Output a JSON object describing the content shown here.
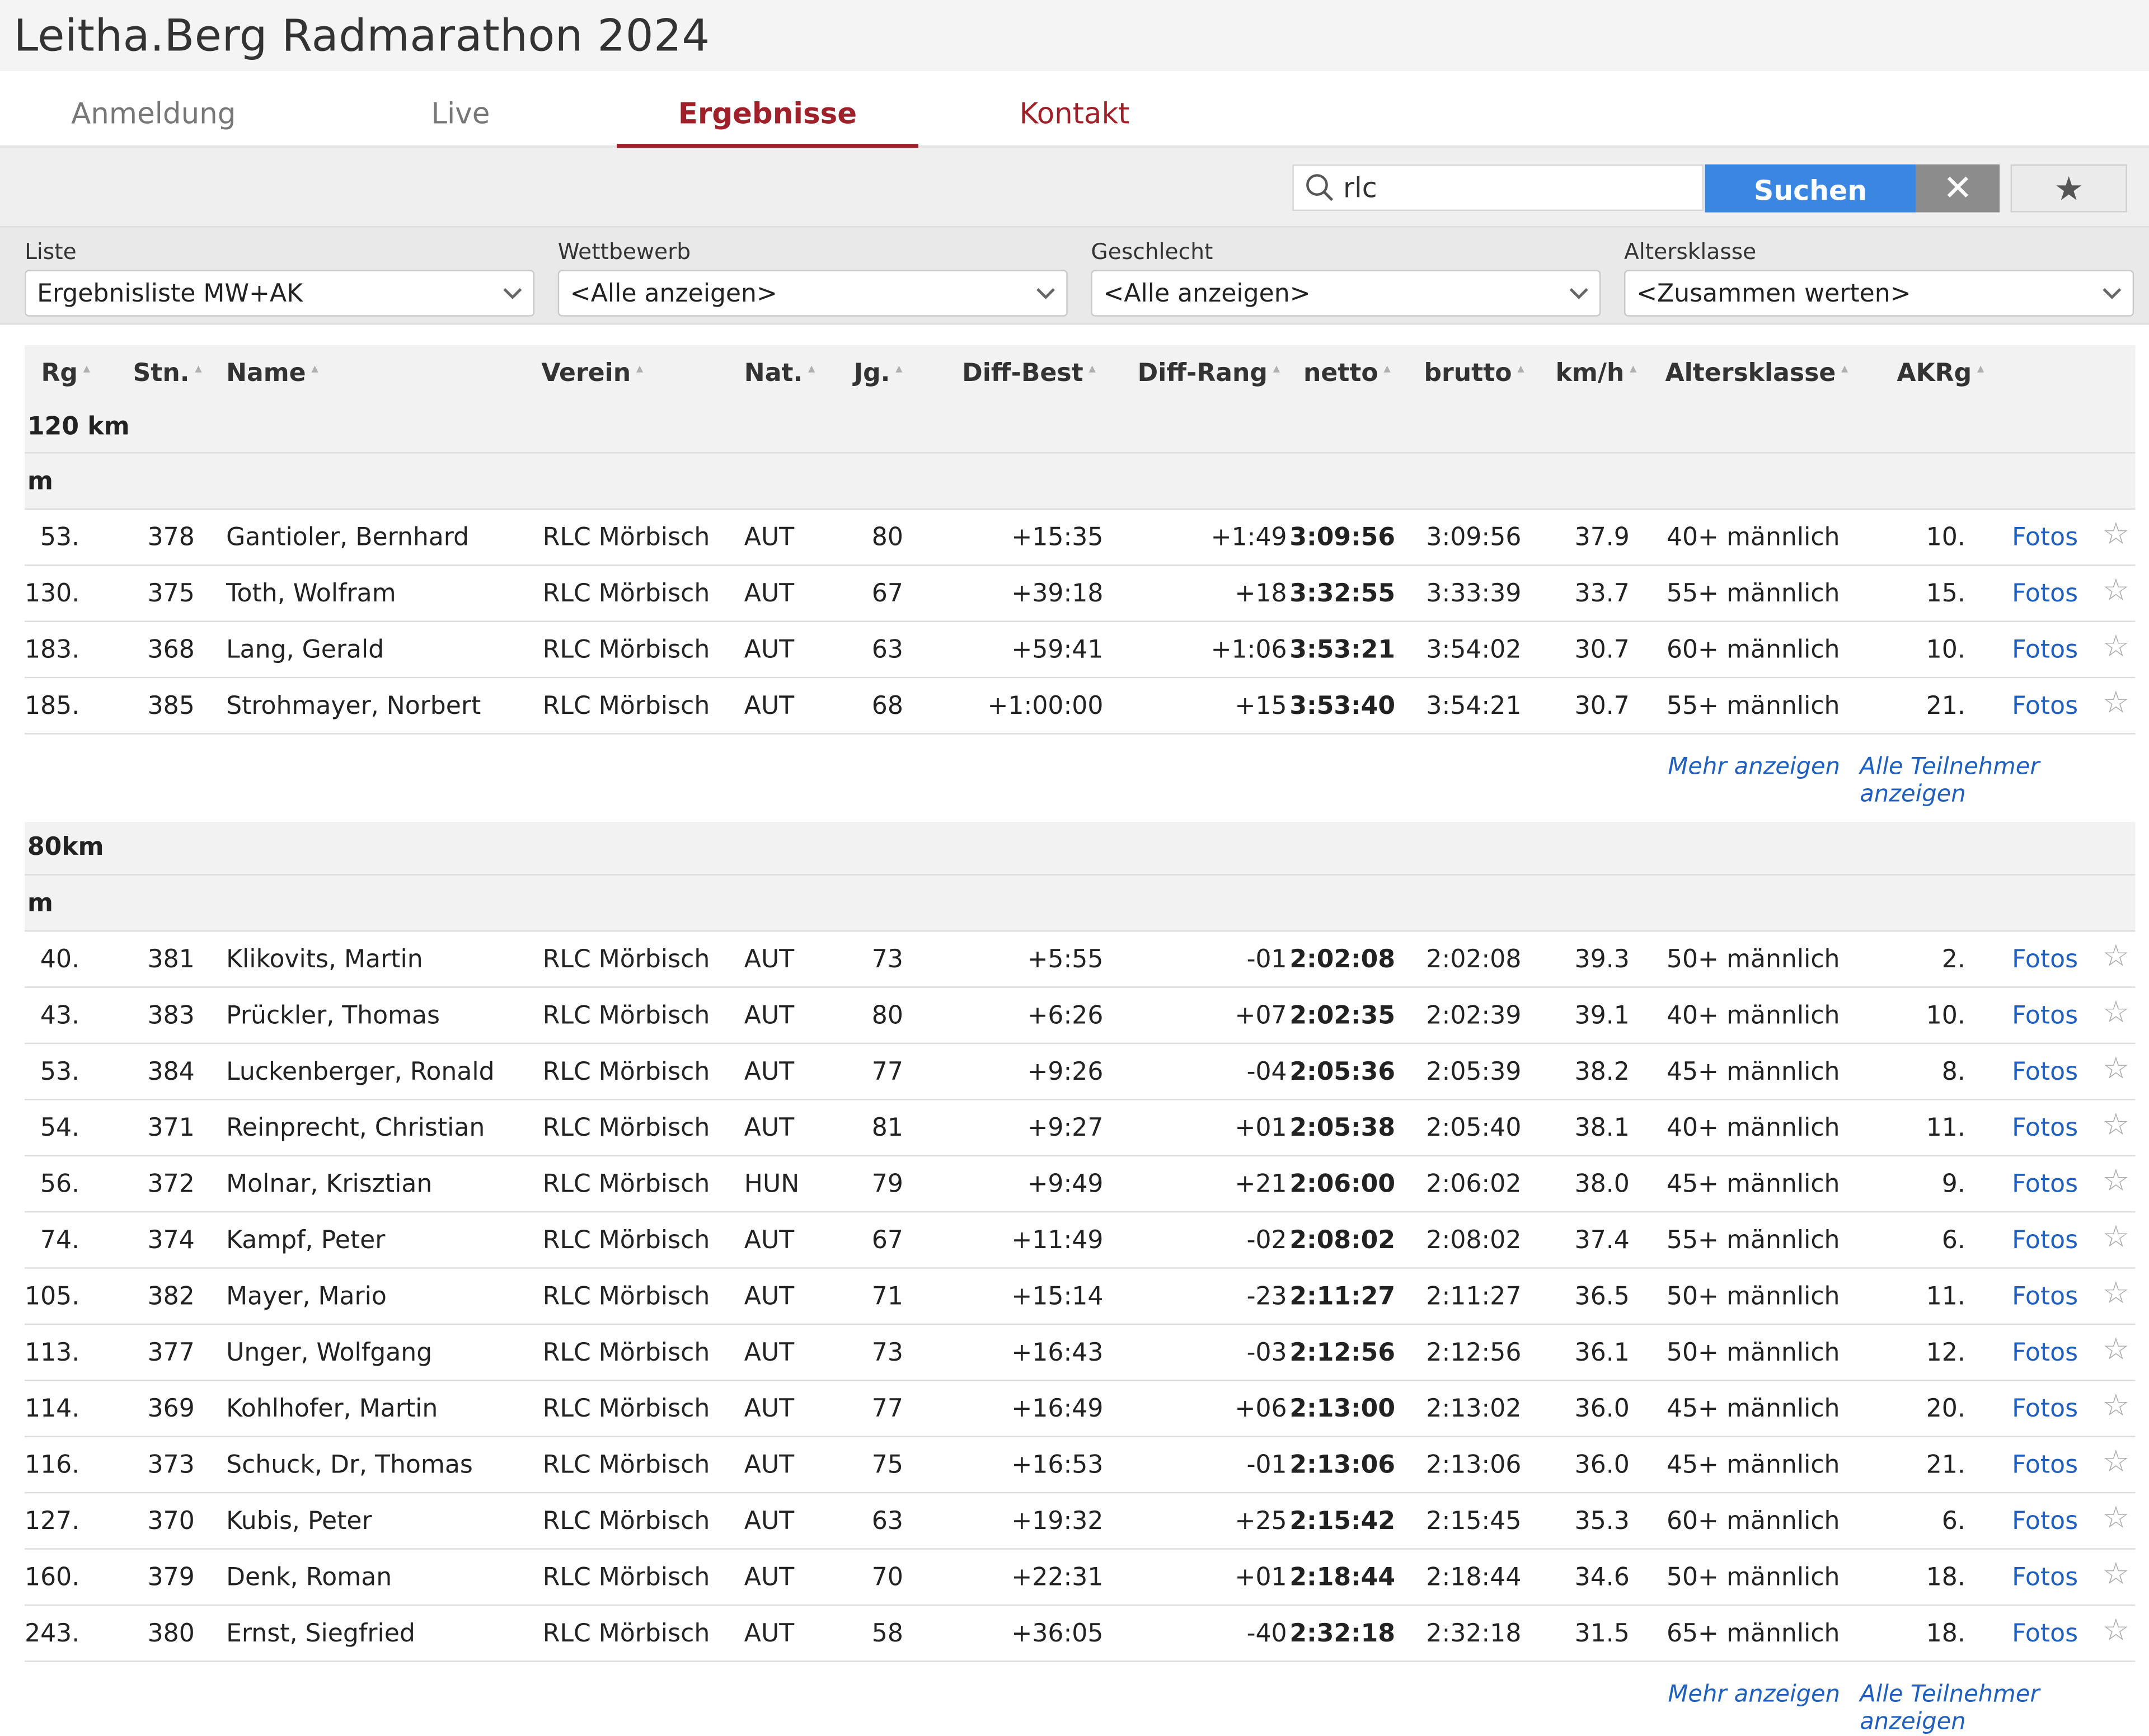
{
  "page": {
    "title": "Leitha.Berg Radmarathon 2024"
  },
  "tabs": [
    {
      "label": "Anmeldung"
    },
    {
      "label": "Live"
    },
    {
      "label": "Ergebnisse"
    },
    {
      "label": "Kontakt"
    }
  ],
  "search": {
    "value": "rlc",
    "button_label": "Suchen",
    "clear_label": "✕",
    "favorite_label": "★"
  },
  "filters": [
    {
      "label": "Liste",
      "value": "Ergebnisliste MW+AK"
    },
    {
      "label": "Wettbewerb",
      "value": "<Alle anzeigen>"
    },
    {
      "label": "Geschlecht",
      "value": "<Alle anzeigen>"
    },
    {
      "label": "Altersklasse",
      "value": "<Zusammen werten>"
    }
  ],
  "columns": [
    "Rg",
    "Stn.",
    "Name",
    "Verein",
    "Nat.",
    "Jg.",
    "Diff-Best",
    "Diff-Rang",
    "netto",
    "brutto",
    "km/h",
    "Altersklasse",
    "AKRg"
  ],
  "links": {
    "photos": "Fotos",
    "more": "Mehr anzeigen",
    "all": "Alle Teilnehmer anzeigen"
  },
  "groups": [
    {
      "title": "120 km",
      "subtitle": "m",
      "rows": [
        [
          "53.",
          "378",
          "Gantioler, Bernhard",
          "RLC Mörbisch",
          "AUT",
          "80",
          "+15:35",
          "+1:49",
          "3:09:56",
          "3:09:56",
          "37.9",
          "40+ männlich",
          "10."
        ],
        [
          "130.",
          "375",
          "Toth, Wolfram",
          "RLC Mörbisch",
          "AUT",
          "67",
          "+39:18",
          "+18",
          "3:32:55",
          "3:33:39",
          "33.7",
          "55+ männlich",
          "15."
        ],
        [
          "183.",
          "368",
          "Lang, Gerald",
          "RLC Mörbisch",
          "AUT",
          "63",
          "+59:41",
          "+1:06",
          "3:53:21",
          "3:54:02",
          "30.7",
          "60+ männlich",
          "10."
        ],
        [
          "185.",
          "385",
          "Strohmayer, Norbert",
          "RLC Mörbisch",
          "AUT",
          "68",
          "+1:00:00",
          "+15",
          "3:53:40",
          "3:54:21",
          "30.7",
          "55+ männlich",
          "21."
        ]
      ]
    },
    {
      "title": "80km",
      "subtitle": "m",
      "rows": [
        [
          "40.",
          "381",
          "Klikovits, Martin",
          "RLC Mörbisch",
          "AUT",
          "73",
          "+5:55",
          "-01",
          "2:02:08",
          "2:02:08",
          "39.3",
          "50+ männlich",
          "2."
        ],
        [
          "43.",
          "383",
          "Prückler, Thomas",
          "RLC Mörbisch",
          "AUT",
          "80",
          "+6:26",
          "+07",
          "2:02:35",
          "2:02:39",
          "39.1",
          "40+ männlich",
          "10."
        ],
        [
          "53.",
          "384",
          "Luckenberger, Ronald",
          "RLC Mörbisch",
          "AUT",
          "77",
          "+9:26",
          "-04",
          "2:05:36",
          "2:05:39",
          "38.2",
          "45+ männlich",
          "8."
        ],
        [
          "54.",
          "371",
          "Reinprecht, Christian",
          "RLC Mörbisch",
          "AUT",
          "81",
          "+9:27",
          "+01",
          "2:05:38",
          "2:05:40",
          "38.1",
          "40+ männlich",
          "11."
        ],
        [
          "56.",
          "372",
          "Molnar, Krisztian",
          "RLC Mörbisch",
          "HUN",
          "79",
          "+9:49",
          "+21",
          "2:06:00",
          "2:06:02",
          "38.0",
          "45+ männlich",
          "9."
        ],
        [
          "74.",
          "374",
          "Kampf, Peter",
          "RLC Mörbisch",
          "AUT",
          "67",
          "+11:49",
          "-02",
          "2:08:02",
          "2:08:02",
          "37.4",
          "55+ männlich",
          "6."
        ],
        [
          "105.",
          "382",
          "Mayer, Mario",
          "RLC Mörbisch",
          "AUT",
          "71",
          "+15:14",
          "-23",
          "2:11:27",
          "2:11:27",
          "36.5",
          "50+ männlich",
          "11."
        ],
        [
          "113.",
          "377",
          "Unger, Wolfgang",
          "RLC Mörbisch",
          "AUT",
          "73",
          "+16:43",
          "-03",
          "2:12:56",
          "2:12:56",
          "36.1",
          "50+ männlich",
          "12."
        ],
        [
          "114.",
          "369",
          "Kohlhofer, Martin",
          "RLC Mörbisch",
          "AUT",
          "77",
          "+16:49",
          "+06",
          "2:13:00",
          "2:13:02",
          "36.0",
          "45+ männlich",
          "20."
        ],
        [
          "116.",
          "373",
          "Schuck, Dr, Thomas",
          "RLC Mörbisch",
          "AUT",
          "75",
          "+16:53",
          "-01",
          "2:13:06",
          "2:13:06",
          "36.0",
          "45+ männlich",
          "21."
        ],
        [
          "127.",
          "370",
          "Kubis, Peter",
          "RLC Mörbisch",
          "AUT",
          "63",
          "+19:32",
          "+25",
          "2:15:42",
          "2:15:45",
          "35.3",
          "60+ männlich",
          "6."
        ],
        [
          "160.",
          "379",
          "Denk, Roman",
          "RLC Mörbisch",
          "AUT",
          "70",
          "+22:31",
          "+01",
          "2:18:44",
          "2:18:44",
          "34.6",
          "50+ männlich",
          "18."
        ],
        [
          "243.",
          "380",
          "Ernst, Siegfried",
          "RLC Mörbisch",
          "AUT",
          "58",
          "+36:05",
          "-40",
          "2:32:18",
          "2:32:18",
          "31.5",
          "65+ männlich",
          "18."
        ]
      ]
    }
  ]
}
